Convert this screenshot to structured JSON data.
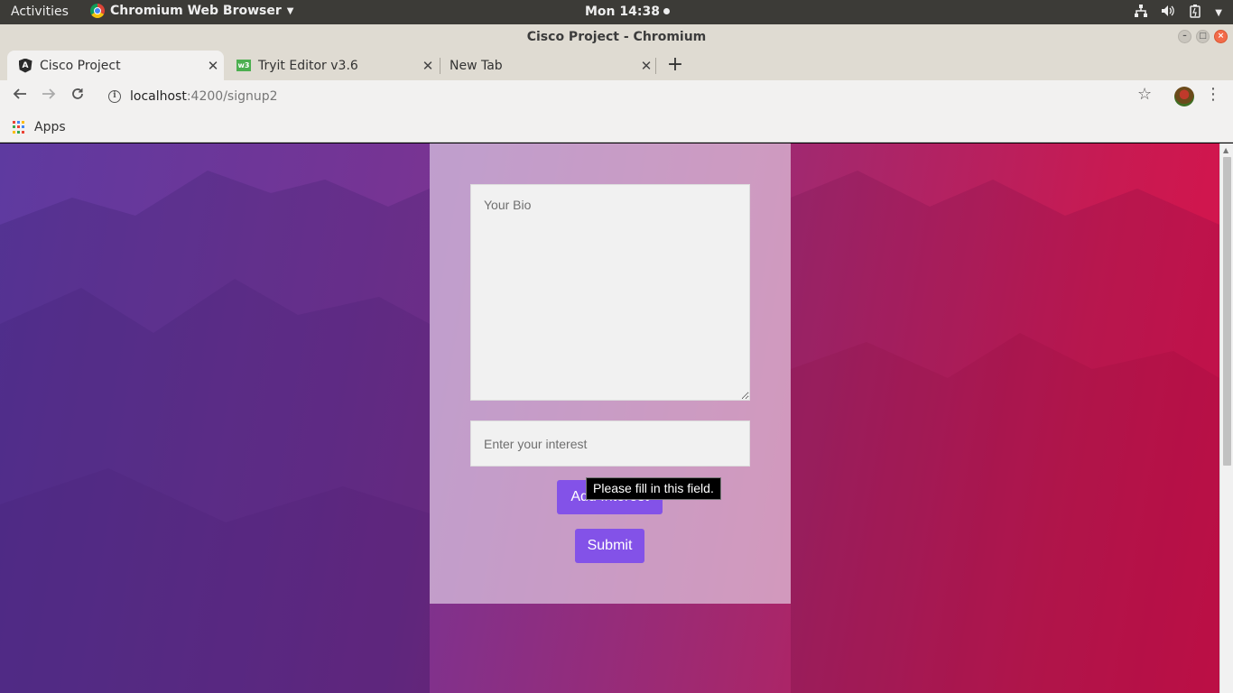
{
  "system_bar": {
    "activities": "Activities",
    "app_name": "Chromium Web Browser",
    "clock": "Mon 14:38"
  },
  "window": {
    "title": "Cisco Project - Chromium"
  },
  "tabs": [
    {
      "label": "Cisco Project",
      "icon": "angular-icon",
      "active": true
    },
    {
      "label": "Tryit Editor v3.6",
      "icon": "w3schools-icon",
      "active": false
    },
    {
      "label": "New Tab",
      "icon": "",
      "active": false
    }
  ],
  "address_bar": {
    "host": "localhost",
    "path": ":4200/signup2"
  },
  "bookmarks": {
    "apps_label": "Apps"
  },
  "form": {
    "bio_placeholder": "Your Bio",
    "interest_placeholder": "Enter your interest",
    "add_interest_label": "Add Interest",
    "submit_label": "Submit"
  },
  "validation": {
    "tooltip": "Please fill in this field."
  },
  "colors": {
    "button": "#8352e8",
    "background_left": "#5e3aa0",
    "background_right": "#d8124a"
  }
}
